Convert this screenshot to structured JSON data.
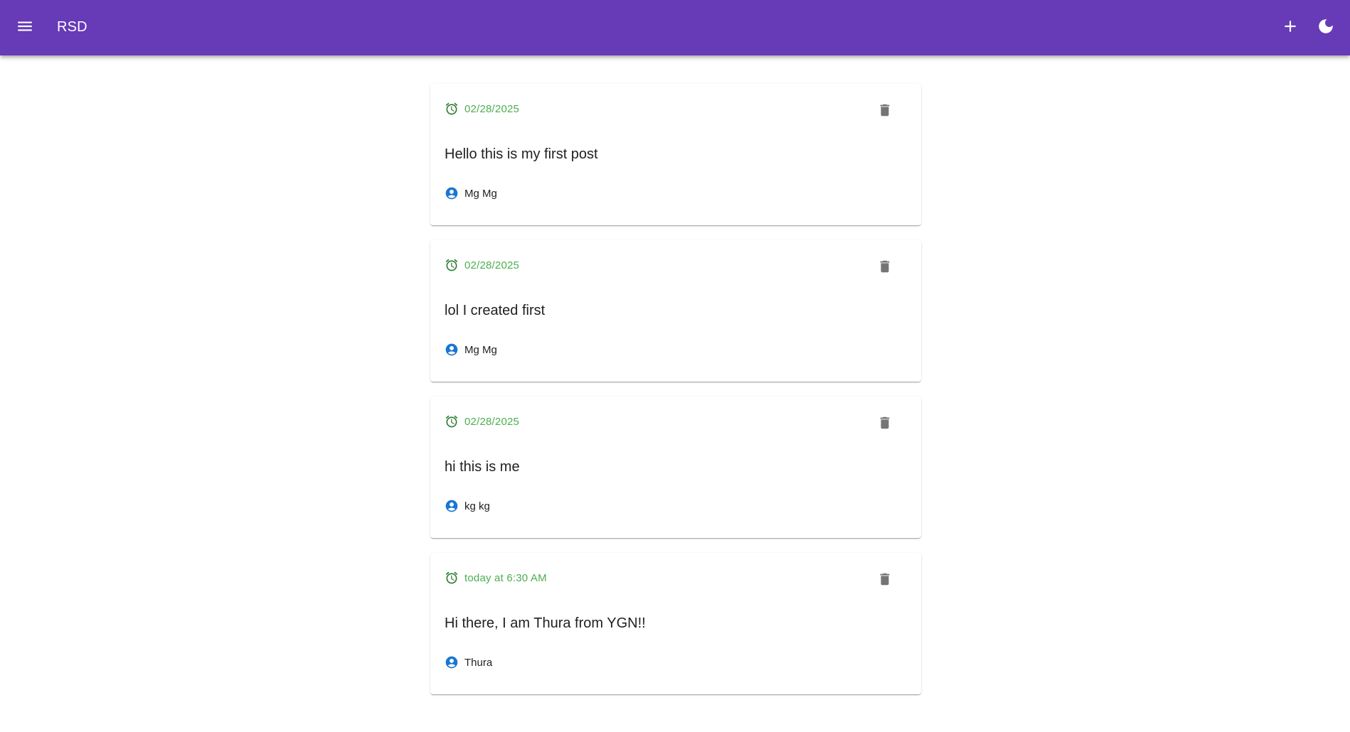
{
  "appbar": {
    "title": "RSD",
    "menu_icon": "menu-icon",
    "add_icon": "add-icon",
    "theme_icon": "dark-mode-moon-icon",
    "color": "#673ab7"
  },
  "colors": {
    "time": "#4caf50",
    "user_icon": "#1976d2",
    "delete_icon": "#757575",
    "text": "#212121"
  },
  "posts": [
    {
      "time": "02/28/2025",
      "content": "Hello this is my first post",
      "user": "Mg Mg"
    },
    {
      "time": "02/28/2025",
      "content": "lol I created first",
      "user": "Mg Mg"
    },
    {
      "time": "02/28/2025",
      "content": "hi this is me",
      "user": "kg kg"
    },
    {
      "time": "today at 6:30 AM",
      "content": "Hi there, I am Thura from YGN!!",
      "user": "Thura"
    }
  ]
}
